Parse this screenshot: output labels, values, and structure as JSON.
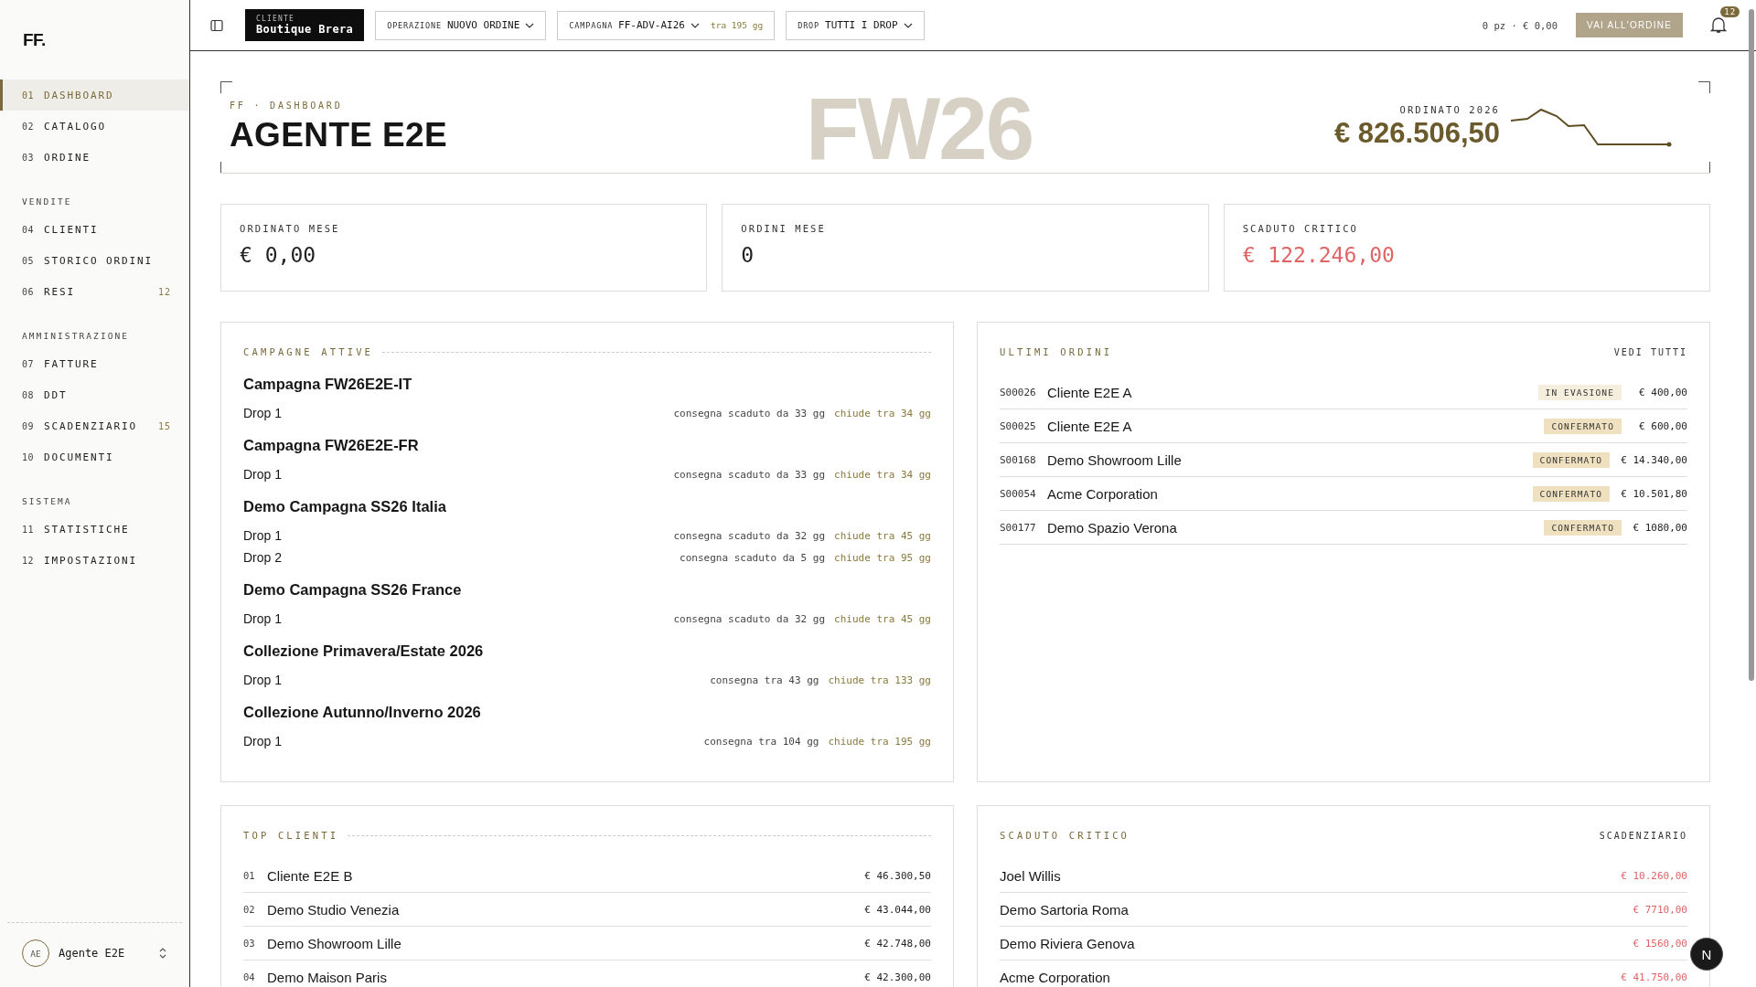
{
  "sidebar": {
    "logo": "FF.",
    "sections": [
      {
        "items": [
          {
            "number": "01",
            "label": "DASHBOARD",
            "selected": true
          },
          {
            "number": "02",
            "label": "CATALOGO",
            "selected": false
          },
          {
            "number": "03",
            "label": "ORDINE",
            "selected": false
          }
        ]
      },
      {
        "heading": "VENDITE",
        "items": [
          {
            "number": "04",
            "label": "CLIENTI",
            "selected": false
          },
          {
            "number": "05",
            "label": "STORICO ORDINI",
            "selected": false
          },
          {
            "number": "06",
            "label": "RESI",
            "badge": "12",
            "selected": false
          }
        ]
      },
      {
        "heading": "AMMINISTRAZIONE",
        "items": [
          {
            "number": "07",
            "label": "FATTURE",
            "selected": false
          },
          {
            "number": "08",
            "label": "DDT",
            "selected": false
          },
          {
            "number": "09",
            "label": "SCADENZIARIO",
            "badge": "15",
            "selected": false
          },
          {
            "number": "10",
            "label": "DOCUMENTI",
            "selected": false
          }
        ]
      },
      {
        "heading": "SISTEMA",
        "items": [
          {
            "number": "11",
            "label": "STATISTICHE",
            "selected": false
          },
          {
            "number": "12",
            "label": "IMPOSTAZIONI",
            "selected": false
          }
        ]
      }
    ],
    "user": {
      "initials": "AE",
      "name": "Agente E2E"
    }
  },
  "topbar": {
    "client": {
      "label": "CLIENTE",
      "value": "Boutique Brera"
    },
    "selectors": [
      {
        "label": "OPERAZIONE",
        "value": "NUOVO ORDINE"
      },
      {
        "label": "CAMPAGNA",
        "value": "FF-ADV-AI26",
        "note": "tra 195 gg"
      },
      {
        "label": "DROP",
        "value": "TUTTI I DROP"
      }
    ],
    "cart_summary": "0 pz · € 0,00",
    "cart_button": "VAI ALL'ORDINE",
    "notifications": "12"
  },
  "header": {
    "breadcrumb": "FF · DASHBOARD",
    "title": "AGENTE E2E",
    "backdrop": "FW26",
    "total_label": "ORDINATO 2026",
    "total_value": "€ 826.506,50"
  },
  "kpis": [
    {
      "label": "ORDINATO MESE",
      "value": "€ 0,00",
      "kind": "normal"
    },
    {
      "label": "ORDINI MESE",
      "value": "0",
      "kind": "normal"
    },
    {
      "label": "SCADUTO CRITICO",
      "value": "€ 122.246,00",
      "kind": "alert"
    }
  ],
  "campaigns": {
    "title": "CAMPAGNE ATTIVE",
    "items": [
      {
        "name": "Campagna FW26E2E-IT",
        "drops": [
          {
            "name": "Drop 1",
            "delivery": "consegna scaduto da 33 gg",
            "closing": "chiude tra 34 gg"
          }
        ]
      },
      {
        "name": "Campagna FW26E2E-FR",
        "drops": [
          {
            "name": "Drop 1",
            "delivery": "consegna scaduto da 33 gg",
            "closing": "chiude tra 34 gg"
          }
        ]
      },
      {
        "name": "Demo Campagna SS26 Italia",
        "drops": [
          {
            "name": "Drop 1",
            "delivery": "consegna scaduto da 32 gg",
            "closing": "chiude tra 45 gg"
          },
          {
            "name": "Drop 2",
            "delivery": "consegna scaduto da 5 gg",
            "closing": "chiude tra 95 gg"
          }
        ]
      },
      {
        "name": "Demo Campagna SS26 France",
        "drops": [
          {
            "name": "Drop 1",
            "delivery": "consegna scaduto da 32 gg",
            "closing": "chiude tra 45 gg"
          }
        ]
      },
      {
        "name": "Collezione Primavera/Estate 2026",
        "drops": [
          {
            "name": "Drop 1",
            "delivery": "consegna tra 43 gg",
            "closing": "chiude tra 133 gg"
          }
        ]
      },
      {
        "name": "Collezione Autunno/Inverno 2026",
        "drops": [
          {
            "name": "Drop 1",
            "delivery": "consegna tra 104 gg",
            "closing": "chiude tra 195 gg"
          }
        ]
      }
    ]
  },
  "orders": {
    "title": "ULTIMI ORDINI",
    "link": "VEDI TUTTI",
    "rows": [
      {
        "code": "S00026",
        "customer": "Cliente E2E A",
        "status": "IN EVASIONE",
        "kind": "processing",
        "amount": "€ 400,00"
      },
      {
        "code": "S00025",
        "customer": "Cliente E2E A",
        "status": "CONFERMATO",
        "kind": "confirmed",
        "amount": "€ 600,00"
      },
      {
        "code": "S00168",
        "customer": "Demo Showroom Lille",
        "status": "CONFERMATO",
        "kind": "confirmed",
        "amount": "€ 14.340,00"
      },
      {
        "code": "S00054",
        "customer": "Acme Corporation",
        "status": "CONFERMATO",
        "kind": "confirmed",
        "amount": "€ 10.501,80"
      },
      {
        "code": "S00177",
        "customer": "Demo Spazio Verona",
        "status": "CONFERMATO",
        "kind": "confirmed",
        "amount": "€ 1080,00"
      }
    ]
  },
  "top_clients": {
    "title": "TOP CLIENTI",
    "rows": [
      {
        "rank": "01",
        "name": "Cliente E2E B",
        "amount": "€ 46.300,50"
      },
      {
        "rank": "02",
        "name": "Demo Studio Venezia",
        "amount": "€ 43.044,00"
      },
      {
        "rank": "03",
        "name": "Demo Showroom Lille",
        "amount": "€ 42.748,00"
      },
      {
        "rank": "04",
        "name": "Demo Maison Paris",
        "amount": "€ 42.300,00"
      }
    ]
  },
  "overdue": {
    "title": "SCADUTO CRITICO",
    "link": "SCADENZIARIO",
    "rows": [
      {
        "name": "Joel Willis",
        "amount": "€ 10.260,00"
      },
      {
        "name": "Demo Sartoria Roma",
        "amount": "€ 7710,00"
      },
      {
        "name": "Demo Riviera Genova",
        "amount": "€ 1560,00"
      },
      {
        "name": "Acme Corporation",
        "amount": "€ 41.750,00"
      }
    ]
  },
  "dev_badge": "N"
}
